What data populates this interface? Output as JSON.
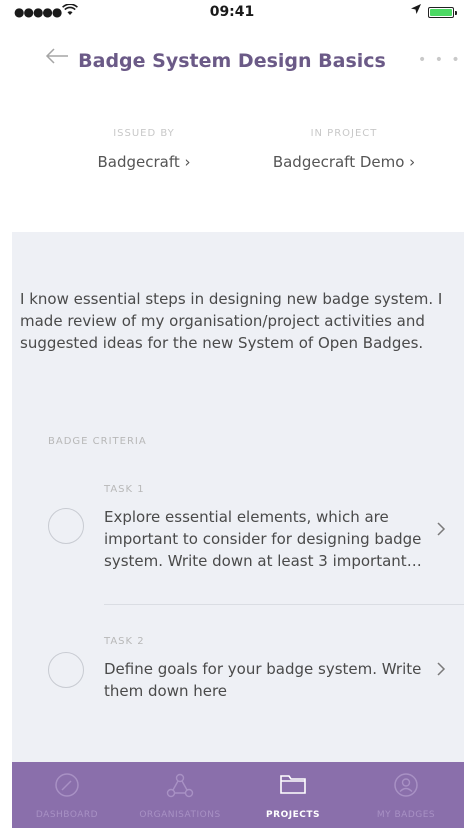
{
  "status_bar": {
    "signal": "●●●●●",
    "time": "09:41"
  },
  "nav": {
    "back_icon": "arrow-left-icon",
    "title": "Badge System Design Basics",
    "more_icon": "more-dots-icon"
  },
  "meta": {
    "issued_by_label": "ISSUED BY",
    "issued_by_value": "Badgecraft ›",
    "project_label": "IN PROJECT",
    "project_value": "Badgecraft Demo ›"
  },
  "description": "I know essential steps in designing new badge system. I made review of my organisation/project activities and suggested ideas for the new System of Open Badges.",
  "criteria": {
    "label": "BADGE CRITERIA",
    "tasks": [
      {
        "label": "TASK 1",
        "text": "Explore essential elements, which are important to consider for designing badge system. Write down at least 3 important…"
      },
      {
        "label": "TASK 2",
        "text": "Define goals for your badge system. Write them down here"
      }
    ]
  },
  "tabbar": {
    "items": [
      {
        "label": "DASHBOARD",
        "icon": "dashboard-gauge-icon",
        "active": false
      },
      {
        "label": "ORGANISATIONS",
        "icon": "organisations-network-icon",
        "active": false
      },
      {
        "label": "PROJECTS",
        "icon": "folder-icon",
        "active": true
      },
      {
        "label": "MY BADGES",
        "icon": "badge-user-icon",
        "active": false
      }
    ]
  },
  "colors": {
    "accent": "#8a6fab",
    "title": "#6b5a87",
    "panel_bg": "#eef0f5",
    "battery": "#4cd964"
  }
}
